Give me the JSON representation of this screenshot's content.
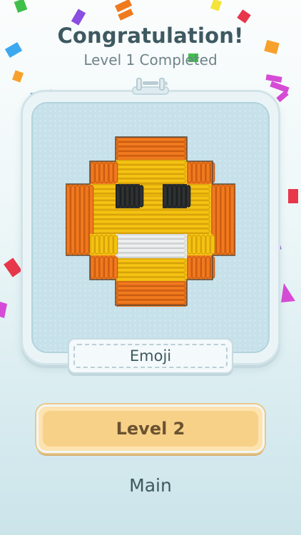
{
  "header": {
    "title": "Congratulation!",
    "subtitle": "Level 1 Completed"
  },
  "artwork": {
    "name": "Emoji"
  },
  "buttons": {
    "next_level_label": "Level 2",
    "main_label": "Main"
  },
  "colors": {
    "thread_orange": "#f07a1e",
    "thread_yellow": "#f5c313",
    "thread_black": "#2f3233",
    "thread_white": "#eef0f0",
    "fabric": "#c6e1ea",
    "button": "#f8d189"
  }
}
